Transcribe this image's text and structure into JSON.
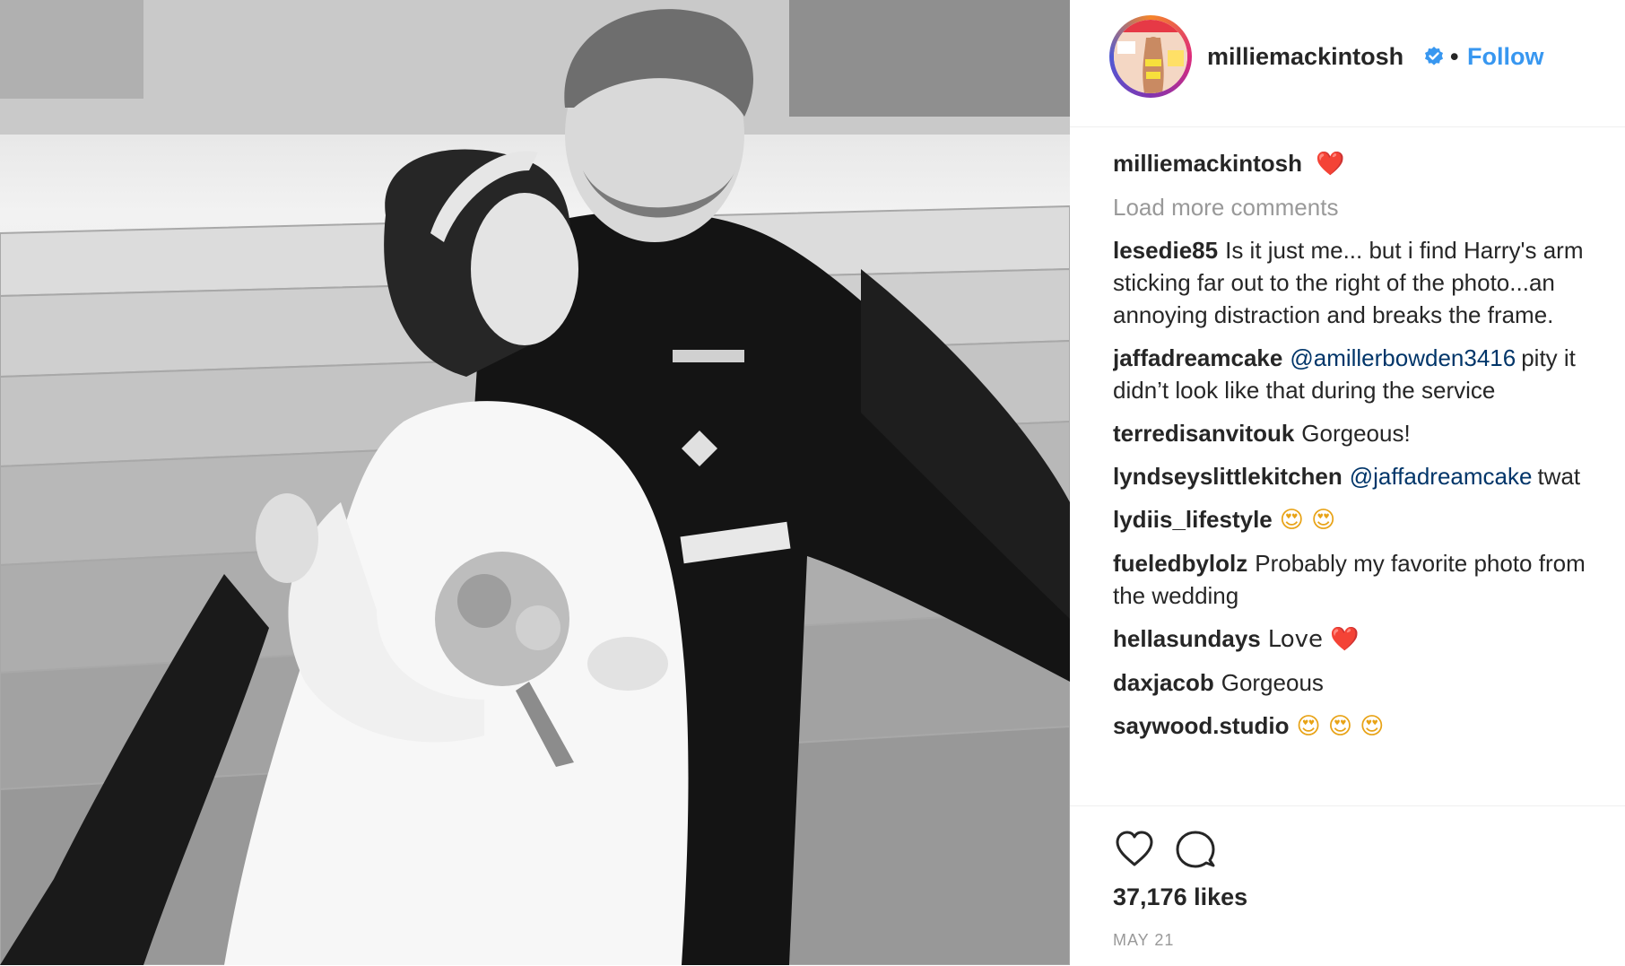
{
  "post": {
    "author": "milliemackintosh",
    "follow_label": "Follow",
    "separator": "•",
    "caption_text": "❤️",
    "load_more": "Load more comments",
    "comments": [
      {
        "user": "lesedie85",
        "mention": "",
        "text": "Is it just me... but i find Harry's arm sticking far out to the right of the photo...an annoying distraction and breaks the frame."
      },
      {
        "user": "jaffadreamcake",
        "mention": "@amillerbowden3416",
        "text": "pity it didn’t look like that during the service"
      },
      {
        "user": "terredisanvitouk",
        "mention": "",
        "text": "Gorgeous!"
      },
      {
        "user": "lyndseyslittlekitchen",
        "mention": "@jaffadreamcake",
        "text": "twat"
      },
      {
        "user": "lydiis_lifestyle",
        "mention": "",
        "text": "😍 😍"
      },
      {
        "user": "fueledbylolz",
        "mention": "",
        "text": "Probably my favorite photo from the wedding"
      },
      {
        "user": "hellasundays",
        "mention": "",
        "text": "Love ❤️"
      },
      {
        "user": "daxjacob",
        "mention": "",
        "text": "Gorgeous"
      },
      {
        "user": "saywood.studio",
        "mention": "",
        "text": "😍 😍 😍"
      }
    ],
    "likes": "37,176 likes",
    "date": "MAY 21"
  },
  "icons": {
    "like": "heart-outline-icon",
    "comment": "speech-bubble-icon",
    "verified": "verified-badge-icon"
  },
  "colors": {
    "follow": "#3897f0",
    "mention": "#003569",
    "muted": "#999999",
    "text": "#262626"
  }
}
